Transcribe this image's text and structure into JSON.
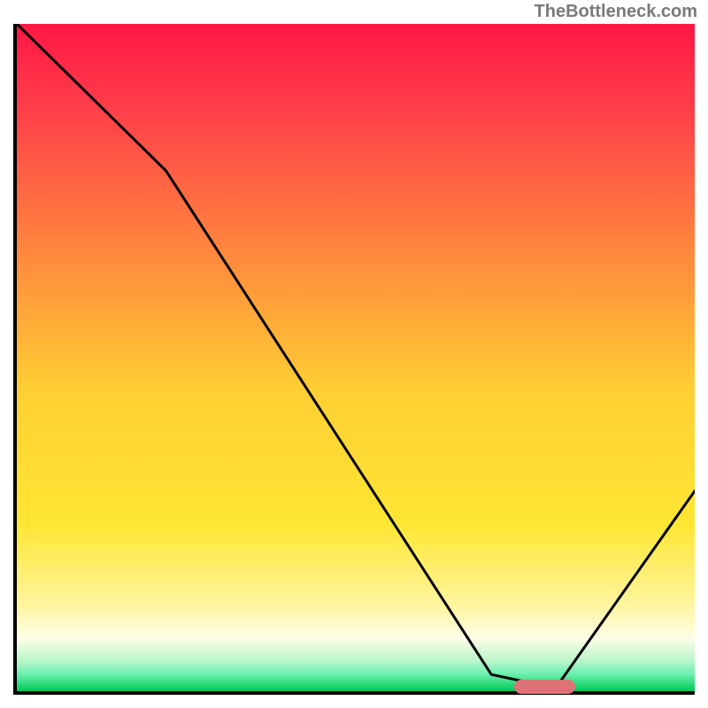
{
  "attribution": "TheBottleneck.com",
  "chart_data": {
    "type": "line",
    "title": "",
    "xlabel": "",
    "ylabel": "",
    "x_range": [
      0,
      100
    ],
    "y_range": [
      0,
      100
    ],
    "series": [
      {
        "name": "bottleneck-curve",
        "points": [
          {
            "x": 0,
            "y": 100
          },
          {
            "x": 22,
            "y": 78
          },
          {
            "x": 70,
            "y": 2.5
          },
          {
            "x": 76,
            "y": 1.2
          },
          {
            "x": 80,
            "y": 1.2
          },
          {
            "x": 100,
            "y": 30
          }
        ]
      }
    ],
    "optimal_marker": {
      "x_start": 73,
      "x_end": 82,
      "y": 1.2
    },
    "background_gradient": {
      "stops": [
        {
          "pos": 0.0,
          "color": "#ff1744"
        },
        {
          "pos": 0.12,
          "color": "#ff3c4a"
        },
        {
          "pos": 0.35,
          "color": "#ff8a3d"
        },
        {
          "pos": 0.55,
          "color": "#ffcf33"
        },
        {
          "pos": 0.75,
          "color": "#ffe633"
        },
        {
          "pos": 0.87,
          "color": "#fff59d"
        },
        {
          "pos": 0.92,
          "color": "#fffde7"
        },
        {
          "pos": 0.955,
          "color": "#b9f6ca"
        },
        {
          "pos": 0.975,
          "color": "#69f0ae"
        },
        {
          "pos": 1.0,
          "color": "#00c853"
        }
      ]
    }
  }
}
